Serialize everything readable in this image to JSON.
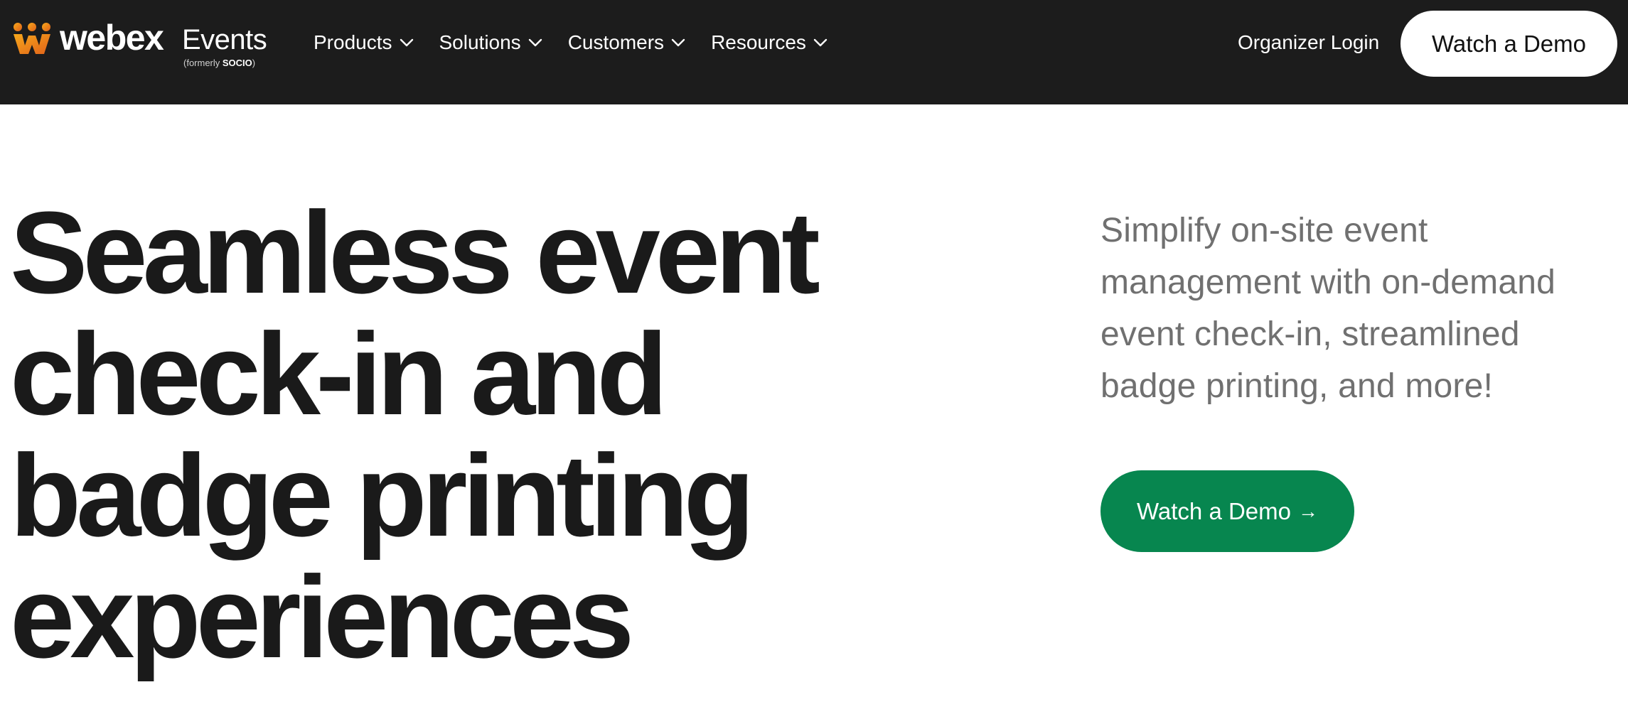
{
  "header": {
    "logo": {
      "wordmark": "webex",
      "product": "Events",
      "formerly_prefix": "(formerly ",
      "formerly_brand": "SOCIO",
      "formerly_suffix": ")"
    },
    "nav": [
      {
        "label": "Products",
        "icon": "chevron-down-icon"
      },
      {
        "label": "Solutions",
        "icon": "chevron-down-icon"
      },
      {
        "label": "Customers",
        "icon": "chevron-down-icon"
      },
      {
        "label": "Resources",
        "icon": "chevron-down-icon"
      }
    ],
    "organizer_login": "Organizer Login",
    "demo_button": "Watch a Demo"
  },
  "hero": {
    "title_lines": [
      "Seamless event",
      "check-in and",
      "badge printing",
      "experiences"
    ],
    "subtitle": "Simplify on-site event management with on-demand event check-in, streamlined badge printing, and more!",
    "cta_label": "Watch a Demo",
    "cta_icon": "arrow-right-icon"
  },
  "colors": {
    "header_bg": "#1c1c1c",
    "cta_green": "#07864f",
    "logo_orange": "#f28c1e",
    "subtitle_gray": "#707070"
  }
}
